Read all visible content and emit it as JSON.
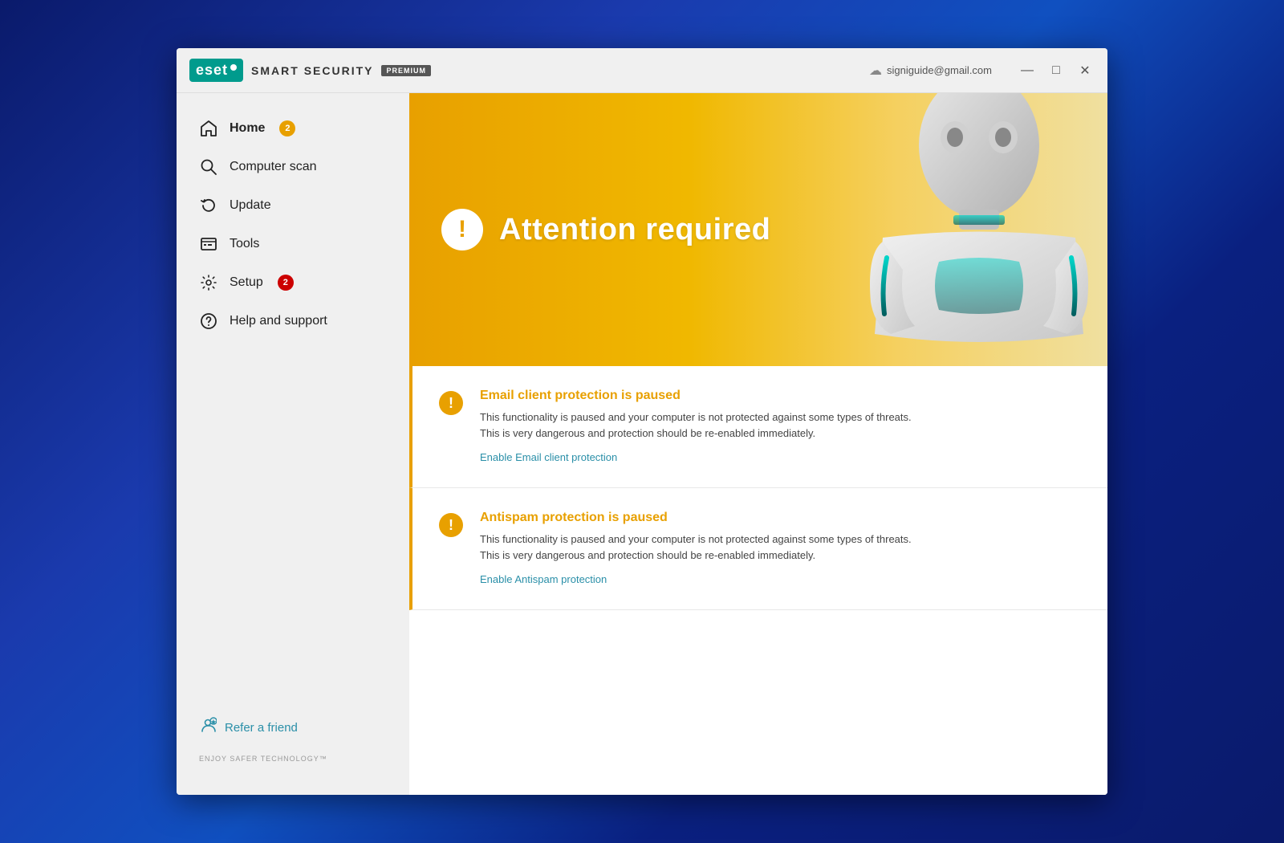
{
  "titlebar": {
    "logo_text": "eset",
    "app_name": "SMART SECURITY",
    "premium_label": "PREMIUM",
    "user_email": "signiguide@gmail.com",
    "minimize": "—",
    "maximize": "□",
    "close": "✕"
  },
  "sidebar": {
    "items": [
      {
        "id": "home",
        "label": "Home",
        "badge": "2",
        "badge_color": "orange",
        "active": true
      },
      {
        "id": "computer-scan",
        "label": "Computer scan",
        "badge": null
      },
      {
        "id": "update",
        "label": "Update",
        "badge": null
      },
      {
        "id": "tools",
        "label": "Tools",
        "badge": null
      },
      {
        "id": "setup",
        "label": "Setup",
        "badge": "2",
        "badge_color": "red"
      },
      {
        "id": "help-and-support",
        "label": "Help and support",
        "badge": null
      }
    ],
    "refer_friend": "Refer a friend",
    "enjoy_text": "ENJOY SAFER TECHNOLOGY™"
  },
  "hero": {
    "attention_text": "Attention required"
  },
  "notifications": [
    {
      "id": "email-protection",
      "title": "Email client protection is paused",
      "description": "This functionality is paused and your computer is not protected against some types of threats.\nThis is very dangerous and protection should be re-enabled immediately.",
      "action_label": "Enable Email client protection"
    },
    {
      "id": "antispam-protection",
      "title": "Antispam protection is paused",
      "description": "This functionality is paused and your computer is not protected against some types of threats.\nThis is very dangerous and protection should be re-enabled immediately.",
      "action_label": "Enable Antispam protection"
    }
  ]
}
